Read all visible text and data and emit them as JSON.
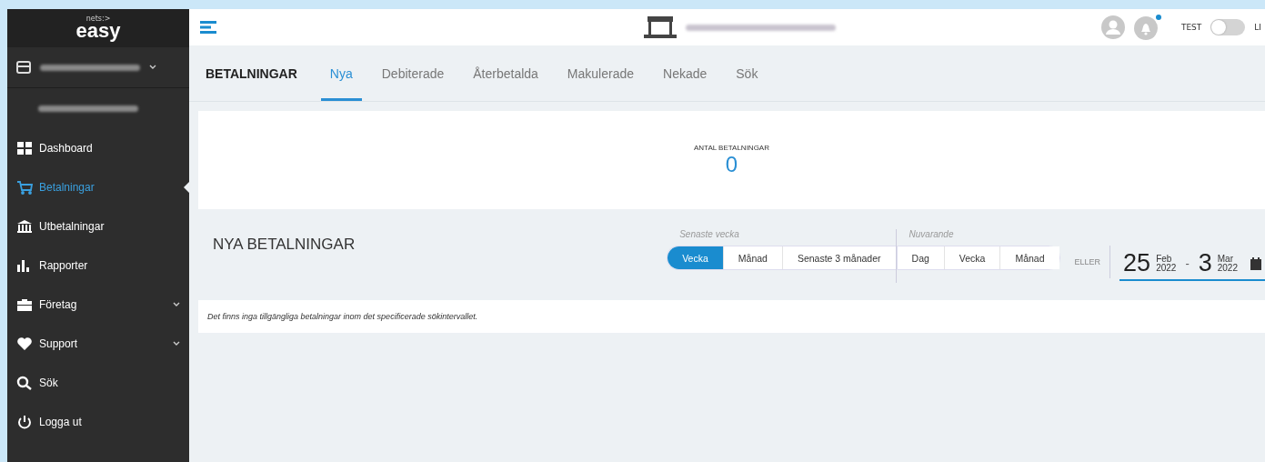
{
  "sidebar": {
    "logo_small": "nets:>",
    "logo": "easy",
    "items": [
      {
        "label": "Dashboard",
        "kind": "grid",
        "selected": false,
        "expandable": false
      },
      {
        "label": "Betalningar",
        "kind": "cart",
        "selected": true,
        "expandable": false
      },
      {
        "label": "Utbetalningar",
        "kind": "bank",
        "selected": false,
        "expandable": false
      },
      {
        "label": "Rapporter",
        "kind": "bars",
        "selected": false,
        "expandable": false
      },
      {
        "label": "Företag",
        "kind": "briefcase",
        "selected": false,
        "expandable": true
      },
      {
        "label": "Support",
        "kind": "heart",
        "selected": false,
        "expandable": true
      },
      {
        "label": "Sök",
        "kind": "search",
        "selected": false,
        "expandable": false
      },
      {
        "label": "Logga ut",
        "kind": "power",
        "selected": false,
        "expandable": false
      }
    ]
  },
  "header": {
    "notification": true,
    "toggle": {
      "left_label": "TEST",
      "right_label": "LI",
      "on": false
    }
  },
  "tabs": {
    "title": "BETALNINGAR",
    "items": [
      {
        "label": "Nya",
        "selected": true
      },
      {
        "label": "Debiterade",
        "selected": false
      },
      {
        "label": "Återbetalda",
        "selected": false
      },
      {
        "label": "Makulerade",
        "selected": false
      },
      {
        "label": "Nekade",
        "selected": false
      },
      {
        "label": "Sök",
        "selected": false
      }
    ]
  },
  "stats": {
    "label": "ANTAL BETALNINGAR",
    "value": "0"
  },
  "section": {
    "title": "NYA BETALNINGAR",
    "groups": [
      {
        "label": "Senaste vecka",
        "buttons": [
          {
            "label": "Vecka",
            "selected": true
          },
          {
            "label": "Månad",
            "selected": false
          },
          {
            "label": "Senaste 3 månader",
            "selected": false
          }
        ]
      },
      {
        "label": "Nuvarande",
        "buttons": [
          {
            "label": "Dag",
            "selected": false
          },
          {
            "label": "Vecka",
            "selected": false
          },
          {
            "label": "Månad",
            "selected": false
          }
        ]
      }
    ],
    "or_label": "ELLER",
    "from": {
      "day": "25",
      "month": "Feb",
      "year": "2022"
    },
    "separator": "-",
    "to": {
      "day": "3",
      "month": "Mar",
      "year": "2022"
    }
  },
  "message": "Det finns inga tillgängliga betalningar inom det specificerade sökintervallet."
}
